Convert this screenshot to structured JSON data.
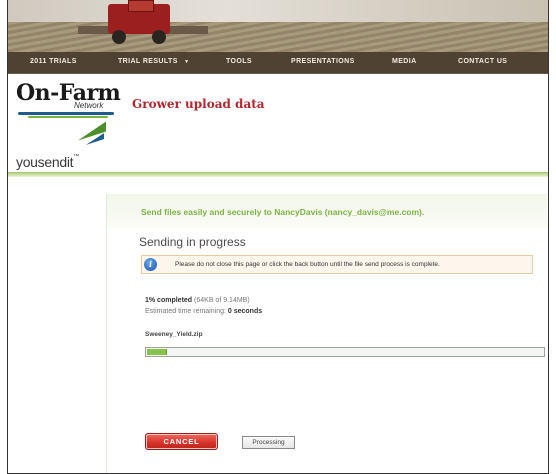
{
  "nav": {
    "items": [
      "2011 TRIALS",
      "TRIAL RESULTS",
      "TOOLS",
      "PRESENTATIONS",
      "MEDIA",
      "CONTACT US"
    ],
    "dropdown_marker": "▼"
  },
  "branding": {
    "logo_main": "On-Farm",
    "logo_sub": "Network",
    "page_title": "Grower upload data",
    "partner_logo": "yousendit",
    "partner_logo_tm": "™"
  },
  "panel": {
    "send_message": "Send files easily and securely to NancyDavis (nancy_davis@me.com).",
    "status_heading": "Sending in progress",
    "notice_icon": "info-icon",
    "notice_text": "Please do not close this page or click the back button until the file send process is complete.",
    "progress": {
      "percent_label": "1% completed",
      "detail": "(64KB of 9.14MB)",
      "eta_label": "Estimated time remaining:",
      "eta_value": "0 seconds",
      "fraction": 0.05
    },
    "file_name": "Sweeney_Yield.zip",
    "cancel_label": "CANCEL",
    "processing_label": "Processing"
  },
  "colors": {
    "accent_green": "#7cb342",
    "title_red": "#b3262c",
    "cancel_red": "#d9342a",
    "nav_bg": "#4f4233"
  }
}
